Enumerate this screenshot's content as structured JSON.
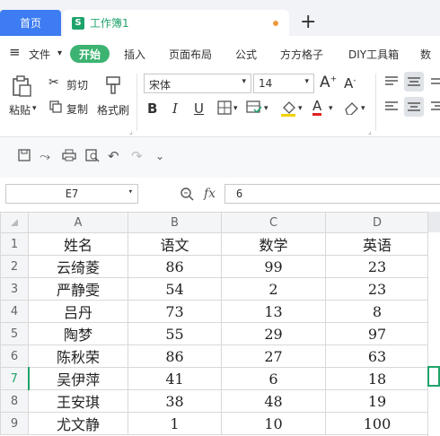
{
  "tabs": {
    "home": "首页",
    "workbook": "工作簿1",
    "workbook_icon": "S",
    "add": "+"
  },
  "menu": {
    "hamburger": "≡",
    "file": "文件",
    "start": "开始",
    "insert": "插入",
    "layout": "页面布局",
    "formula": "公式",
    "fangfang": "方方格子",
    "diy": "DIY工具箱",
    "more": "数"
  },
  "ribbon": {
    "paste": "粘贴",
    "cut": "剪切",
    "copy": "复制",
    "format_painter": "格式刷",
    "font_name": "宋体",
    "font_size": "14",
    "bold": "B",
    "italic": "I",
    "underline": "U",
    "font_color_letter": "A"
  },
  "cell_ref": "E7",
  "formula_value": "6",
  "fx": "fx",
  "columns": [
    "A",
    "B",
    "C",
    "D"
  ],
  "rows": [
    {
      "n": "1",
      "a": "姓名",
      "b": "语文",
      "c": "数学",
      "d": "英语"
    },
    {
      "n": "2",
      "a": "云绮菱",
      "b": "86",
      "c": "99",
      "d": "23"
    },
    {
      "n": "3",
      "a": "严静雯",
      "b": "54",
      "c": "2",
      "d": "23"
    },
    {
      "n": "4",
      "a": "吕丹",
      "b": "73",
      "c": "13",
      "d": "8"
    },
    {
      "n": "5",
      "a": "陶梦",
      "b": "55",
      "c": "29",
      "d": "97"
    },
    {
      "n": "6",
      "a": "陈秋荣",
      "b": "86",
      "c": "27",
      "d": "63"
    },
    {
      "n": "7",
      "a": "吴伊萍",
      "b": "41",
      "c": "6",
      "d": "18"
    },
    {
      "n": "8",
      "a": "王安琪",
      "b": "38",
      "c": "48",
      "d": "19"
    },
    {
      "n": "9",
      "a": "尤文静",
      "b": "1",
      "c": "10",
      "d": "100"
    }
  ],
  "colors": {
    "accent_blue": "#3d7cf2",
    "accent_green": "#1fa36b",
    "start_green": "#3cb371"
  }
}
